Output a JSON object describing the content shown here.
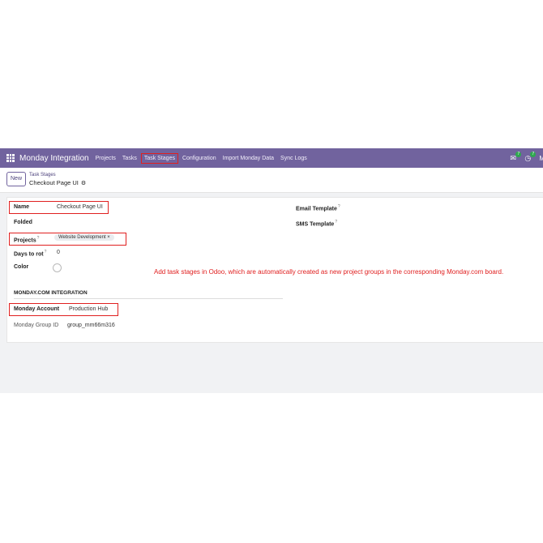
{
  "navbar": {
    "brand": "Monday Integration",
    "menu": [
      "Projects",
      "Tasks",
      "Task Stages",
      "Configuration",
      "Import Monday Data",
      "Sync Logs"
    ],
    "highlighted_menu": "Task Stages",
    "messages_badge": "7",
    "activities_badge": "7",
    "user_initial": "M",
    "color": "#71639e"
  },
  "control": {
    "new_label": "New",
    "breadcrumb_parent": "Task Stages",
    "breadcrumb_current": "Checkout Page UI"
  },
  "form": {
    "name_label": "Name",
    "name_value": "Checkout Page UI",
    "folded_label": "Folded",
    "projects_label": "Projects",
    "projects_help": "?",
    "projects_tag": "Website Development",
    "tag_remove": "×",
    "days_label": "Days to rot",
    "days_help": "?",
    "days_value": "0",
    "color_label": "Color",
    "email_label": "Email Template",
    "email_help": "?",
    "sms_label": "SMS Template",
    "sms_help": "?",
    "section_title": "MONDAY.COM INTEGRATION",
    "account_label": "Monday Account",
    "account_value": "Production Hub",
    "group_label": "Monday Group ID",
    "group_value": "group_mm66m316"
  },
  "annotation": "Add task stages in Odoo, which are automatically created as new project groups in the corresponding Monday.com board.",
  "colors": {
    "highlight": "#e02020",
    "accent": "#71639e"
  }
}
